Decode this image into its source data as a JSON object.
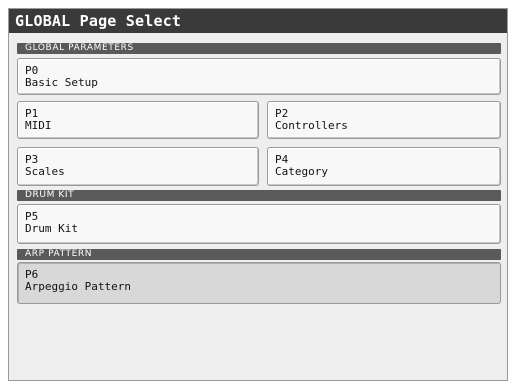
{
  "window": {
    "title": "GLOBAL  Page Select"
  },
  "sections": [
    {
      "header": "GLOBAL PARAMETERS",
      "buttons": [
        {
          "code": "P0",
          "name": "Basic Setup"
        },
        {
          "code": "P1",
          "name": "MIDI"
        },
        {
          "code": "P2",
          "name": "Controllers"
        },
        {
          "code": "P3",
          "name": "Scales"
        },
        {
          "code": "P4",
          "name": "Category"
        }
      ]
    },
    {
      "header": "DRUM KIT",
      "buttons": [
        {
          "code": "P5",
          "name": "Drum Kit"
        }
      ]
    },
    {
      "header": "ARP PATTERN",
      "buttons": [
        {
          "code": "P6",
          "name": "Arpeggio Pattern"
        }
      ]
    }
  ],
  "selected_page": "P6"
}
